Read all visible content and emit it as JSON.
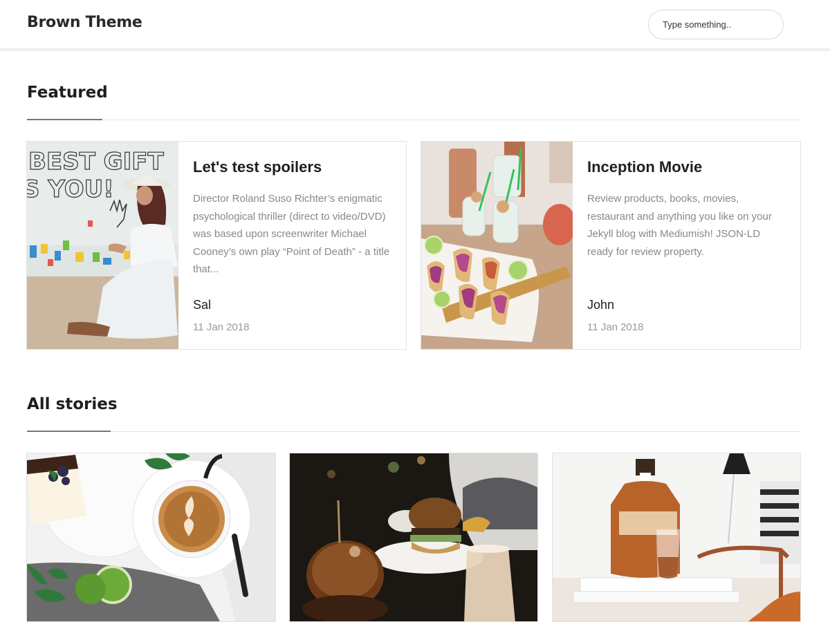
{
  "header": {
    "brand": "Brown Theme",
    "search_placeholder": "Type something.."
  },
  "featured": {
    "title": "Featured",
    "posts": [
      {
        "title": "Let's test spoilers",
        "excerpt": "Director Roland Suso Richter’s enigmatic psychological thriller (direct to video/DVD) was based upon screenwriter Michael Cooney’s own play “Point of Death” - a title that...",
        "author": "Sal",
        "date": "11 Jan 2018"
      },
      {
        "title": "Inception Movie",
        "excerpt": "Review products, books, movies, restaurant and anything you like on your Jekyll blog with Mediumish! JSON-LD ready for review property.",
        "author": "John",
        "date": "11 Jan 2018"
      }
    ]
  },
  "stories": {
    "title": "All stories"
  }
}
